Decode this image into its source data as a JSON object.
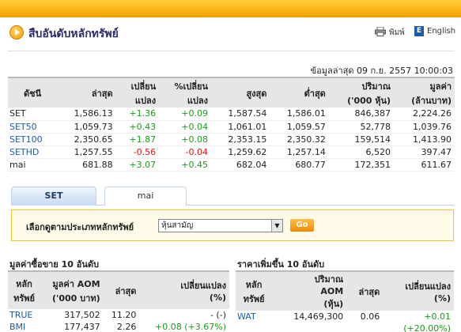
{
  "header": {
    "title": "สืบอันดับหลักทรัพย์",
    "print_label": "พิมพ์",
    "lang_label": "English",
    "lang_icon": "E"
  },
  "update_text": "ข้อมูลล่าสุด 09 ก.ย. 2557 10:00:03",
  "index_table": {
    "headers": [
      "ดัชนี",
      "ล่าสุด",
      "เปลี่ยน\nแปลง",
      "%เปลี่ยน\nแปลง",
      "สูงสุด",
      "ต่ำสุด",
      "ปริมาณ\n('000 หุ้น)",
      "มูลค่า\n(ล้านบาท)"
    ],
    "rows": [
      {
        "name": "SET",
        "last": "1,586.13",
        "change": "+1.36",
        "pct": "+0.09",
        "high": "1,587.54",
        "low": "1,586.01",
        "volume": "846,387",
        "value": "2,224.26",
        "dir": "up",
        "link": false
      },
      {
        "name": "SET50",
        "last": "1,059.73",
        "change": "+0.43",
        "pct": "+0.04",
        "high": "1,061.01",
        "low": "1,059.57",
        "volume": "52,778",
        "value": "1,039.76",
        "dir": "up",
        "link": true
      },
      {
        "name": "SET100",
        "last": "2,350.65",
        "change": "+1.87",
        "pct": "+0.08",
        "high": "2,353.15",
        "low": "2,350.32",
        "volume": "159,514",
        "value": "1,413.90",
        "dir": "up",
        "link": true
      },
      {
        "name": "SETHD",
        "last": "1,257.55",
        "change": "-0.56",
        "pct": "-0.04",
        "high": "1,259.62",
        "low": "1,257.14",
        "volume": "6,520",
        "value": "397.47",
        "dir": "down",
        "link": true
      },
      {
        "name": "mai",
        "last": "681.88",
        "change": "+3.07",
        "pct": "+0.45",
        "high": "682.04",
        "low": "680.77",
        "volume": "172,351",
        "value": "611.67",
        "dir": "up",
        "link": false
      }
    ]
  },
  "tabs": [
    {
      "label": "SET",
      "active": true
    },
    {
      "label": "mai",
      "active": false
    }
  ],
  "filter": {
    "label": "เลือกดูตามประเภทหลักทรัพย์",
    "selected": "หุ้นสามัญ",
    "go_label": "Go"
  },
  "left_section": {
    "title": "มูลค่าซื้อขาย 10 อันดับ",
    "headers": [
      "หลัก\nทรัพย์",
      "มูลค่า AOM\n('000 บาท)",
      "ล่าสุด",
      "เปลี่ยนแปลง\n(%)"
    ],
    "rows": [
      {
        "name": "TRUE",
        "value": "317,502",
        "last": "11.20",
        "change": "- (-)",
        "dir": "none"
      },
      {
        "name": "BMI",
        "value": "177,437",
        "last": "2.26",
        "change": "+0.08 (+3.67%)",
        "dir": "up"
      }
    ]
  },
  "right_section": {
    "title": "ราคาเพิ่มขึ้น 10 อันดับ",
    "headers": [
      "หลัก\nทรัพย์",
      "ปริมาณ\nAOM\n(หุ้น)",
      "ล่าสุด",
      "เปลี่ยนแปลง\n(%)"
    ],
    "rows": [
      {
        "name": "WAT",
        "volume": "14,469,300",
        "last": "0.06",
        "change": "+0.01",
        "dir": "up"
      },
      {
        "name": "",
        "volume": "",
        "last": "",
        "change": "(+20.00%)",
        "dir": "up"
      }
    ]
  },
  "colors": {
    "up": "#1a9a1a",
    "down": "#dd1111",
    "link": "#1d5aa8",
    "accent": "#f5a300"
  }
}
